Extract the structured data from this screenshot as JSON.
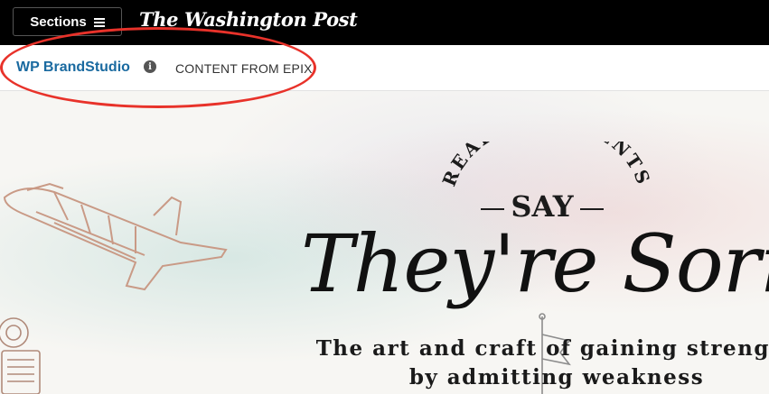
{
  "topbar": {
    "sections_label": "Sections",
    "menu_icon": "hamburger-icon",
    "logo_text": "The Washington Post"
  },
  "brandbar": {
    "brand_name": "WP BrandStudio",
    "info_icon": "info-icon",
    "content_label": "CONTENT FROM EPIX"
  },
  "annotation": {
    "color": "#e8322a"
  },
  "hero": {
    "kicker": "REAL PRESIDENTS",
    "say": "SAY",
    "headline": "They're Sorry",
    "subhead_line1": "The art and craft of gaining strength",
    "subhead_line2": "by admitting weakness"
  }
}
